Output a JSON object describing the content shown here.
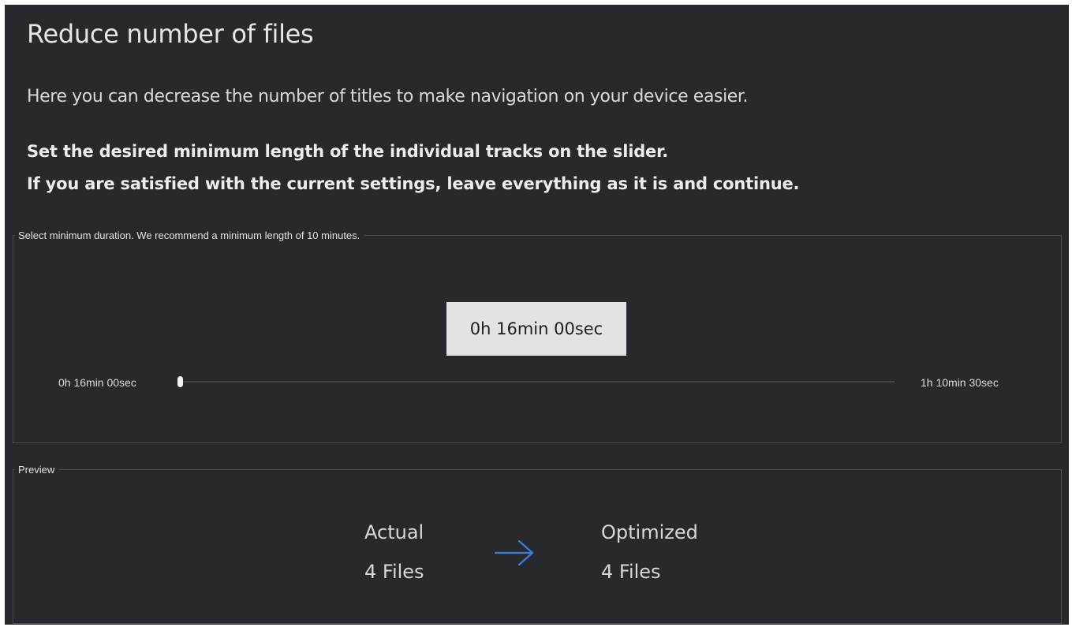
{
  "header": {
    "title": "Reduce number of files",
    "subtitle": "Here you can decrease the number of titles to make navigation on your device easier.",
    "instruction_line1": "Set the desired minimum length of the individual tracks on the slider.",
    "instruction_line2": "If you are satisfied with the current settings, leave everything as it is and continue."
  },
  "duration": {
    "legend": "Select minimum duration. We recommend a minimum length of 10 minutes.",
    "current_value": "0h 16min 00sec",
    "min_label": "0h 16min 00sec",
    "max_label": "1h 10min 30sec",
    "slider_fraction": 0.0
  },
  "preview": {
    "legend": "Preview",
    "actual_label": "Actual",
    "actual_value": "4 Files",
    "optimized_label": "Optimized",
    "optimized_value": "4 Files",
    "arrow_icon": "arrow-right-icon"
  },
  "colors": {
    "background": "#28292d",
    "accent_arrow": "#3b7fd6",
    "value_box": "#e3e3e3"
  }
}
